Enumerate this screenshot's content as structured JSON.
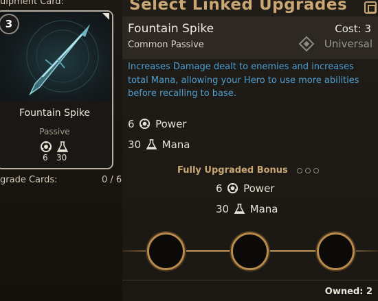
{
  "left": {
    "header": "uipment Card:",
    "card": {
      "cost": "3",
      "name": "Fountain Spike",
      "type": "Passive",
      "stats": [
        {
          "icon": "power-icon",
          "value": "6"
        },
        {
          "icon": "mana-flask-icon",
          "value": "30"
        }
      ]
    },
    "upgrade_cards_label": "grade Cards:",
    "upgrade_cards_count": "0 / 6"
  },
  "right": {
    "title": "Select Linked Upgrades",
    "upgrade": {
      "name": "Fountain Spike",
      "cost": "Cost: 3",
      "rarity": "Common Passive",
      "affinity": "Universal",
      "description": "Increases Damage dealt to enemies and increases total Mana, allowing your Hero to use more abilities before recalling to base."
    },
    "stats": [
      {
        "value": "6",
        "icon": "power-icon",
        "label": "Power"
      },
      {
        "value": "30",
        "icon": "mana-flask-icon",
        "label": "Mana"
      }
    ],
    "bonus": {
      "title": "Fully Upgraded Bonus",
      "stats": [
        {
          "value": "6",
          "icon": "power-icon",
          "label": "Power"
        },
        {
          "value": "30",
          "icon": "mana-flask-icon",
          "label": "Mana"
        }
      ]
    },
    "owned": "Owned: 2"
  },
  "colors": {
    "gold": "#c9a673",
    "description_blue": "#4d9fd2",
    "slot_ring": "#b88a4c"
  }
}
